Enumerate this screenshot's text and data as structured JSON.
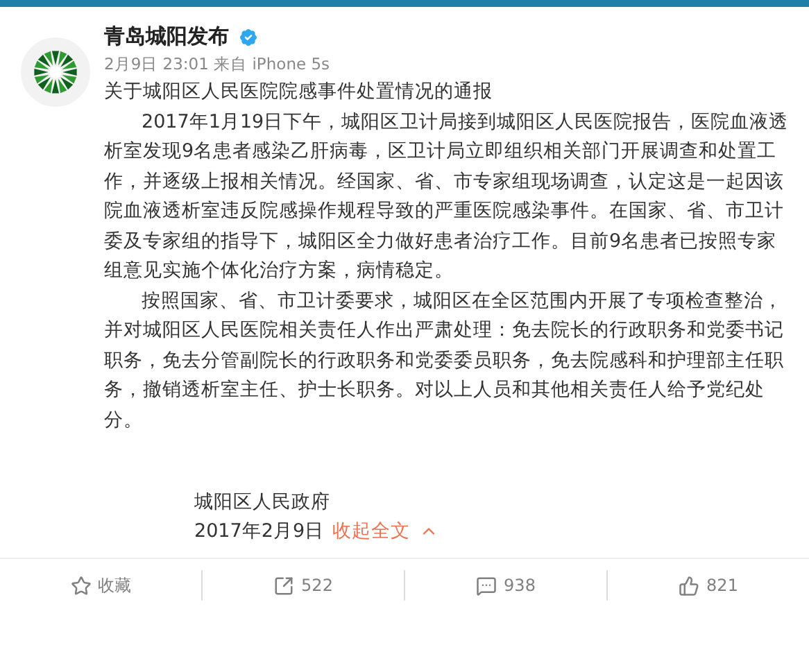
{
  "post": {
    "author": "青岛城阳发布",
    "verified": true,
    "meta": "2月9日 23:01 来自 iPhone 5s",
    "title": "关于城阳区人民医院院感事件处置情况的通报",
    "paragraphs": [
      "2017年1月19日下午，城阳区卫计局接到城阳区人民医院报告，医院血液透析室发现9名患者感染乙肝病毒，区卫计局立即组织相关部门开展调查和处置工作，并逐级上报相关情况。经国家、省、市专家组现场调查，认定这是一起因该院血液透析室违反院感操作规程导致的严重医院感染事件。在国家、省、市卫计委及专家组的指导下，城阳区全力做好患者治疗工作。目前9名患者已按照专家组意见实施个体化治疗方案，病情稳定。",
      "按照国家、省、市卫计委要求，城阳区在全区范围内开展了专项检查整治，并对城阳区人民医院相关责任人作出严肃处理：免去院长的行政职务和党委书记职务，免去分管副院长的行政职务和党委委员职务，免去院感科和护理部主任职务，撤销透析室主任、护士长职务。对以上人员和其他相关责任人给予党纪处分。"
    ],
    "signature": "城阳区人民政府",
    "date": "2017年2月9日",
    "collapse_link": "收起全文"
  },
  "actions": [
    {
      "kind": "favorite",
      "label": "收藏"
    },
    {
      "kind": "share",
      "label": "522"
    },
    {
      "kind": "comment",
      "label": "938"
    },
    {
      "kind": "like",
      "label": "821"
    }
  ]
}
